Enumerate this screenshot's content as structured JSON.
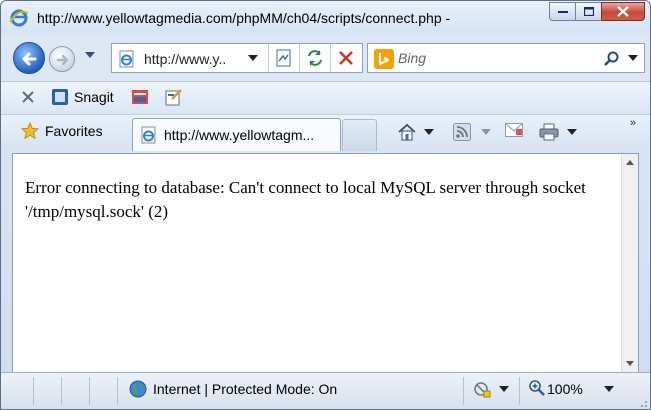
{
  "window": {
    "title": "http://www.yellowtagmedia.com/phpMM/ch04/scripts/connect.php -",
    "controls": [
      "minimize",
      "maximize",
      "close"
    ]
  },
  "nav": {
    "address_display": "http://www.y..",
    "search_placeholder": "Bing"
  },
  "toolbar": {
    "snagit_label": "Snagit"
  },
  "favorites": {
    "label": "Favorites",
    "tab_title": "http://www.yellowtagm..."
  },
  "content": {
    "message": "Error connecting to database: Can't connect to local MySQL server through socket '/tmp/mysql.sock' (2)"
  },
  "status": {
    "zone": "Internet | Protected Mode: On",
    "zoom": "100%"
  },
  "colors": {
    "accent_blue": "#1f5fc0",
    "close_red": "#c64838",
    "chrome_bg": "#d5e3f3"
  },
  "icons": [
    "ie-icon",
    "back-arrow-icon",
    "forward-arrow-icon",
    "compat-view-icon",
    "refresh-icon",
    "stop-icon",
    "bing-icon",
    "search-icon",
    "close-x-icon",
    "snagit-icon",
    "star-icon",
    "home-icon",
    "rss-icon",
    "mail-icon",
    "print-icon",
    "globe-icon",
    "zoom-icon"
  ]
}
